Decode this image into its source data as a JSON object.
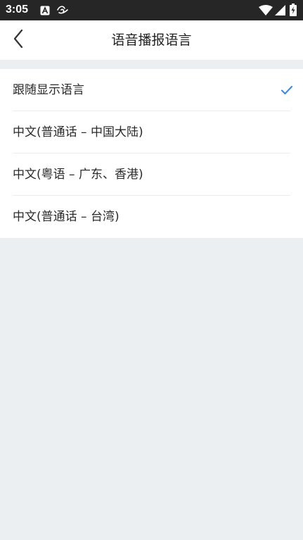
{
  "status_bar": {
    "time": "3:05",
    "icons": [
      "a-notification-icon",
      "signal-swirl-icon",
      "wifi-icon",
      "cell-signal-icon",
      "battery-charging-icon"
    ]
  },
  "header": {
    "title": "语音播报语言",
    "back_icon": "back-arrow-icon"
  },
  "options": [
    {
      "label": "跟随显示语言",
      "selected": true
    },
    {
      "label": "中文(普通话 – 中国大陆)",
      "selected": false
    },
    {
      "label": "中文(粤语 – 广东、香港)",
      "selected": false
    },
    {
      "label": "中文(普通话 – 台湾)",
      "selected": false
    }
  ],
  "colors": {
    "accent": "#3b87e0",
    "background": "#eceff2",
    "status_bar": "#262626"
  }
}
